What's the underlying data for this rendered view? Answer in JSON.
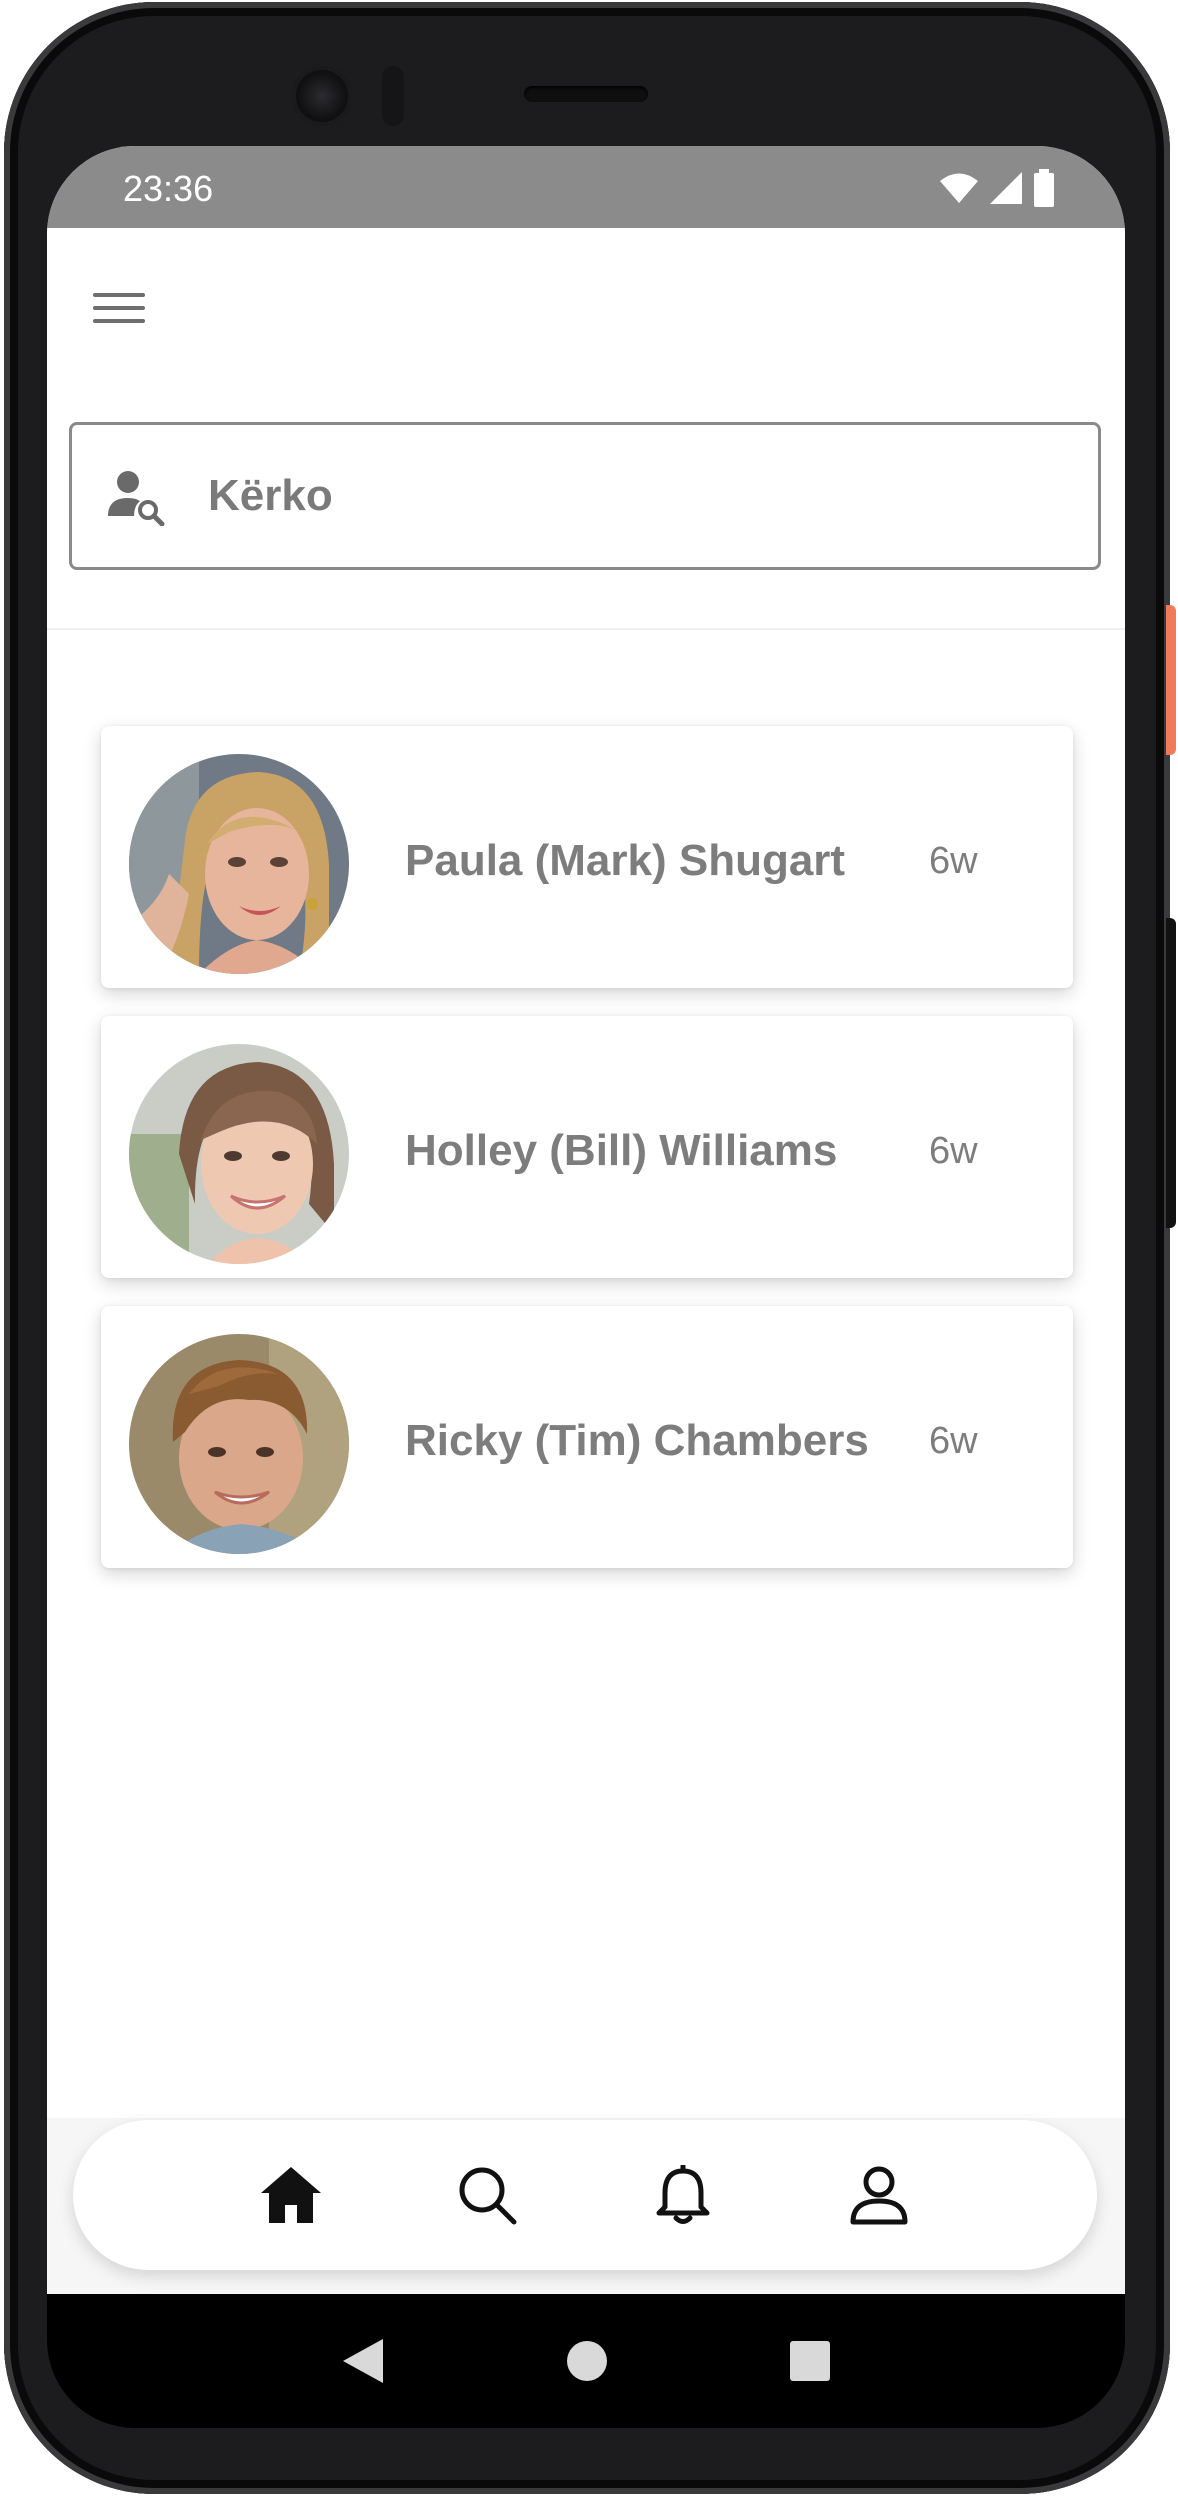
{
  "status_bar": {
    "time": "23:36",
    "icons": [
      "wifi-icon",
      "cell-signal-icon",
      "battery-icon"
    ]
  },
  "app_bar": {
    "menu_icon": "hamburger-menu-icon"
  },
  "search": {
    "icon": "person-search-icon",
    "placeholder": "Kërko",
    "value": ""
  },
  "contacts": [
    {
      "name": "Paula (Mark) Shugart",
      "time": "6w",
      "avatar": "avatar-woman-blonde"
    },
    {
      "name": "Holley (Bill) Williams",
      "time": "6w",
      "avatar": "avatar-woman-brown-hair"
    },
    {
      "name": "Ricky (Tim) Chambers",
      "time": "6w",
      "avatar": "avatar-young-man"
    }
  ],
  "bottom_nav": {
    "items": [
      {
        "icon": "home-icon",
        "active": true
      },
      {
        "icon": "search-icon",
        "active": false
      },
      {
        "icon": "bell-icon",
        "active": false
      },
      {
        "icon": "person-icon",
        "active": false
      }
    ]
  },
  "system_nav": [
    "back-icon",
    "home-circle-icon",
    "recents-icon"
  ],
  "colors": {
    "status_bar": "#8b8b8b",
    "text_gray": "#7d7d7d",
    "accent_side_button": "#f07b5c"
  }
}
